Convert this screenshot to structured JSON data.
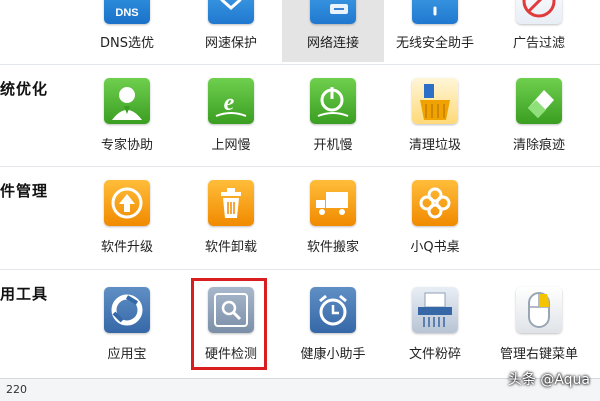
{
  "sections": [
    {
      "label": "",
      "tools": [
        {
          "label": "DNS选优",
          "icon": "dns-icon",
          "badge": "DNS"
        },
        {
          "label": "网速保护",
          "icon": "shield-icon"
        },
        {
          "label": "网络连接",
          "icon": "network-link-icon",
          "selected": true
        },
        {
          "label": "无线安全助手",
          "icon": "wifi-shield-icon"
        },
        {
          "label": "广告过滤",
          "icon": "ad-filter-icon"
        }
      ]
    },
    {
      "label": "统优化",
      "tools": [
        {
          "label": "专家协助",
          "icon": "expert-doctor-icon"
        },
        {
          "label": "上网慢",
          "icon": "browser-snail-icon"
        },
        {
          "label": "开机慢",
          "icon": "power-snail-icon"
        },
        {
          "label": "清理垃圾",
          "icon": "broom-icon"
        },
        {
          "label": "清除痕迹",
          "icon": "eraser-icon"
        }
      ]
    },
    {
      "label": "件管理",
      "tools": [
        {
          "label": "软件升级",
          "icon": "upgrade-arrow-icon"
        },
        {
          "label": "软件卸载",
          "icon": "trash-icon"
        },
        {
          "label": "软件搬家",
          "icon": "moving-truck-icon"
        },
        {
          "label": "小Q书桌",
          "icon": "clover-icon"
        }
      ]
    },
    {
      "label": "用工具",
      "tools": [
        {
          "label": "应用宝",
          "icon": "app-store-icon"
        },
        {
          "label": "硬件检测",
          "icon": "hardware-check-icon",
          "highlighted": true
        },
        {
          "label": "健康小助手",
          "icon": "alarm-clock-icon"
        },
        {
          "label": "文件粉碎",
          "icon": "shredder-icon"
        },
        {
          "label": "管理右键菜单",
          "icon": "mouse-icon"
        }
      ]
    }
  ],
  "status": {
    "text": "220"
  },
  "watermark": {
    "text": "头条 @Aqua"
  },
  "colors": {
    "highlight": "#d81e1e",
    "selected_bg": "#e4e4e4"
  }
}
